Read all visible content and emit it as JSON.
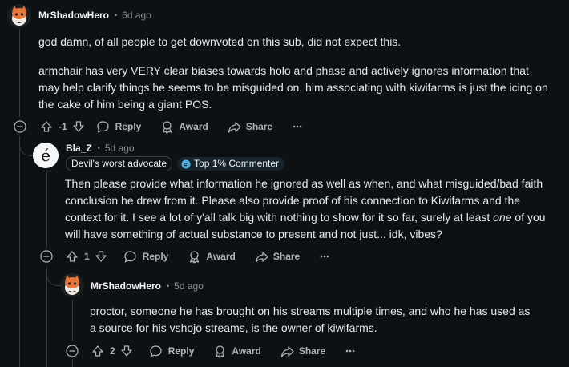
{
  "comments": [
    {
      "author": "MrShadowHero",
      "time": "6d ago",
      "paragraphs": [
        "god damn, of all people to get downvoted on this sub, did not expect this.",
        "armchair has very VERY clear biases towards holo and phase and actively ignores information that may help clarify things he seems to be misguided on. him associating with kiwifarms is just the icing on the cake of him being a giant POS."
      ],
      "score": "-1",
      "reply_label": "Reply",
      "award_label": "Award",
      "share_label": "Share"
    },
    {
      "author": "Bla_Z",
      "time": "5d ago",
      "flair": "Devil's worst advocate",
      "commenter_badge": "Top 1% Commenter",
      "text_before_em": "Then please provide what information he ignored as well as when, and what misguided/bad faith conclusion he drew from it. Please also provide proof of his connection to Kiwifarms and the context for it. I see a lot of y'all talk big with nothing to show for it so far, surely at least ",
      "text_em": "one",
      "text_after_em": " of you will have something of actual substance to present and not just... idk, vibes?",
      "score": "1",
      "reply_label": "Reply",
      "award_label": "Award",
      "share_label": "Share"
    },
    {
      "author": "MrShadowHero",
      "time": "5d ago",
      "paragraphs": [
        "proctor, someone he has brought on his streams multiple times, and who he has used as a source for his vshojo streams, is the owner of kiwifarms."
      ],
      "score": "2",
      "reply_label": "Reply",
      "award_label": "Award",
      "share_label": "Share"
    }
  ],
  "colors": {
    "background": "#0e1113",
    "thread_line": "#33393d",
    "meta_text": "#8a9296",
    "action_text": "#aeb5b9",
    "avatar_orange": "#e8763a"
  },
  "icons": [
    "snoo-avatar",
    "e-letter-avatar",
    "collapse-minus-icon",
    "upvote-icon",
    "downvote-icon",
    "reply-bubble-icon",
    "award-icon",
    "share-arrow-icon",
    "more-dots-icon",
    "commenter-badge-icon"
  ]
}
